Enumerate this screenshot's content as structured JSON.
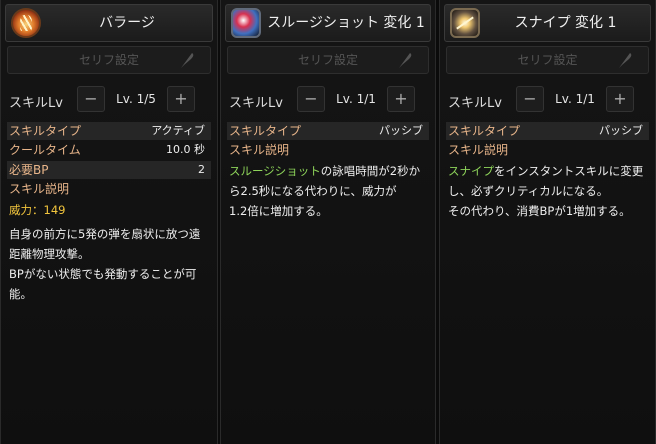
{
  "common": {
    "serif_label": "セリフ設定",
    "skill_lv_label": "スキルLv",
    "minus": "−",
    "plus": "+",
    "skill_type_label": "スキルタイプ",
    "skill_desc_label": "スキル説明"
  },
  "panels": [
    {
      "title": "バラージ",
      "icon": "barrage-icon",
      "level": "Lv. 1/5",
      "skill_type": "アクティブ",
      "cooldown_label": "クールタイム",
      "cooldown": "10.0 秒",
      "bp_label": "必要BP",
      "bp": "2",
      "power_label": "威力：",
      "power": "149",
      "desc_lines": [
        "自身の前方に5発の弾を扇状に放つ遠",
        "距離物理攻撃。",
        "BPがない状態でも発動することが可",
        "能。"
      ]
    },
    {
      "title": "スルージショット 変化 1",
      "icon": "slug-shot-icon",
      "level": "Lv. 1/1",
      "skill_type": "パッシブ",
      "desc_highlight": "スルージショット",
      "desc_line1_rest": "の詠唱時間が2秒か",
      "desc_lines": [
        "ら2.5秒になる代わりに、威力が",
        "1.2倍に増加する。"
      ]
    },
    {
      "title": "スナイプ 変化 1",
      "icon": "snipe-icon",
      "level": "Lv. 1/1",
      "skill_type": "パッシブ",
      "desc_highlight": "スナイプ",
      "desc_line1_rest": "をインスタントスキルに変更",
      "desc_lines": [
        "し、必ずクリティカルになる。",
        "その代わり、消費BPが1増加する。"
      ]
    }
  ],
  "colors": {
    "label": "#e8b58a",
    "highlight": "#8ed45a",
    "power": "#f2c53d"
  }
}
